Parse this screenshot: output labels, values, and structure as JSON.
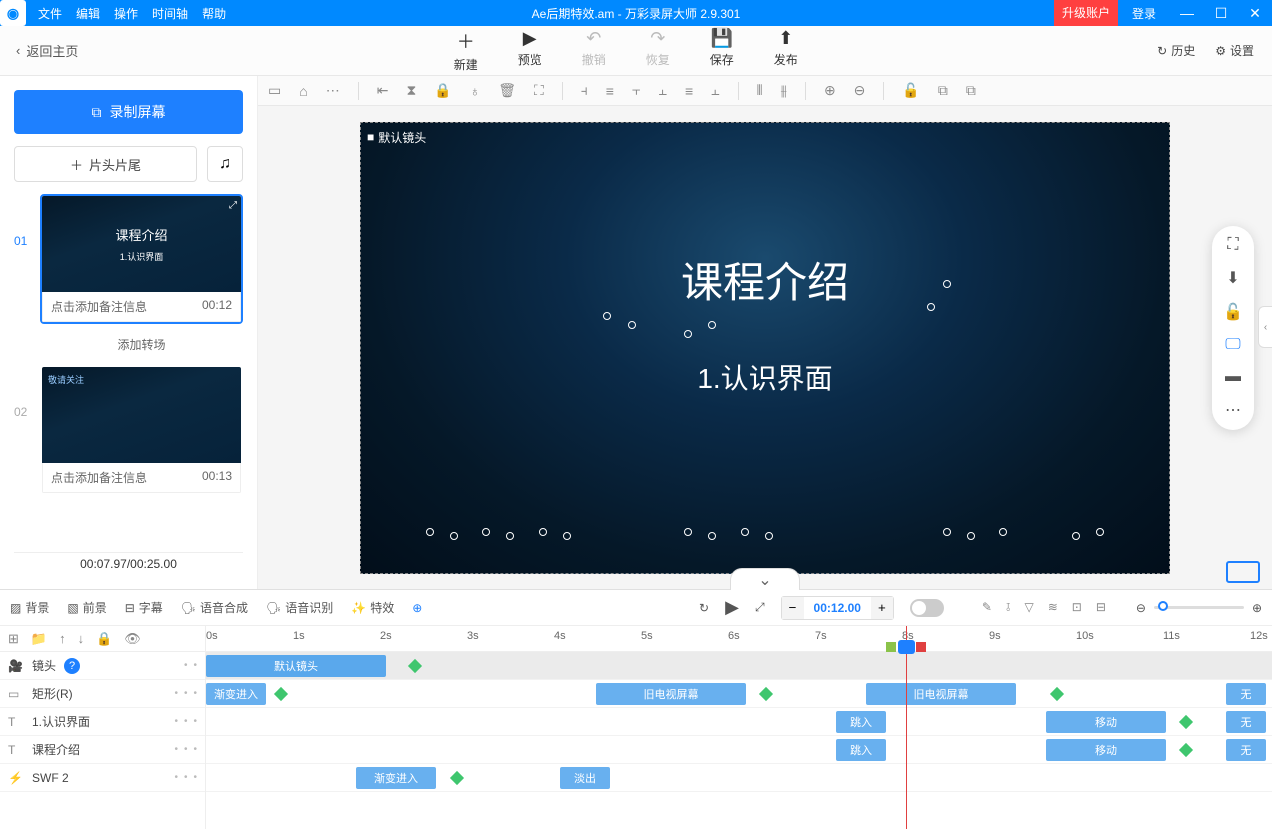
{
  "titlebar": {
    "menus": [
      "文件",
      "编辑",
      "操作",
      "时间轴",
      "帮助"
    ],
    "title": "Ae后期特效.am - 万彩录屏大师 2.9.301",
    "upgrade": "升级账户",
    "login": "登录"
  },
  "topbar": {
    "back": "返回主页",
    "actions": [
      {
        "icon": "＋",
        "label": "新建",
        "disabled": false
      },
      {
        "icon": "▶",
        "label": "预览",
        "disabled": false
      },
      {
        "icon": "↶",
        "label": "撤销",
        "disabled": true
      },
      {
        "icon": "↷",
        "label": "恢复",
        "disabled": true
      },
      {
        "icon": "💾",
        "label": "保存",
        "disabled": false
      },
      {
        "icon": "⬆",
        "label": "发布",
        "disabled": false
      }
    ],
    "history": "历史",
    "settings": "设置"
  },
  "sidebar": {
    "record": "录制屏幕",
    "head_tail": "片头片尾",
    "add_trans": "添加转场",
    "time_display": "00:07.97/00:25.00",
    "clips": [
      {
        "idx": "01",
        "title": "课程介绍",
        "sub": "1.认识界面",
        "note": "点击添加备注信息",
        "dur": "00:12",
        "active": true
      },
      {
        "idx": "02",
        "title": "",
        "sub": "",
        "note": "点击添加备注信息",
        "dur": "00:13",
        "active": false
      }
    ]
  },
  "canvas": {
    "corner_label": "默认镜头",
    "title": "课程介绍",
    "sub": "1.认识界面"
  },
  "bottom": {
    "tabs": [
      "背景",
      "前景",
      "字幕",
      "语音合成",
      "语音识别",
      "特效"
    ],
    "time_value": "00:12.00",
    "ruler": [
      "0s",
      "1s",
      "2s",
      "3s",
      "4s",
      "5s",
      "6s",
      "7s",
      "8s",
      "9s",
      "10s",
      "11s",
      "12s"
    ],
    "tracks": [
      {
        "icon": "🎥",
        "name": "镜头",
        "help": true
      },
      {
        "icon": "▭",
        "name": "矩形(R)"
      },
      {
        "icon": "T",
        "name": "1.认识界面"
      },
      {
        "icon": "T",
        "name": "课程介绍"
      },
      {
        "icon": "⚡",
        "name": "SWF 2"
      }
    ],
    "segs": {
      "default_shot": "默认镜头",
      "grad_in": "渐变进入",
      "old_tv": "旧电视屏幕",
      "jump_in": "跳入",
      "move": "移动",
      "none": "无",
      "fade_out": "淡出"
    }
  }
}
